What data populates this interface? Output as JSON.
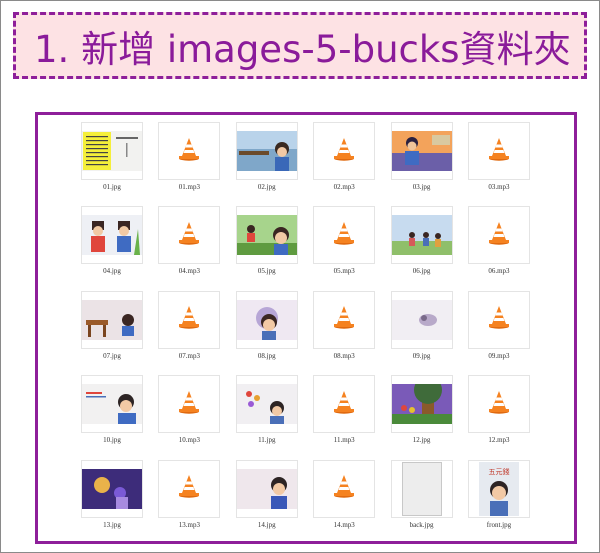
{
  "title": "1. 新增 images-5-bucks資料夾",
  "colors": {
    "banner_bg": "#fde2e4",
    "banner_border": "#8e1f9a",
    "title_text": "#8a1b9a",
    "panel_border": "#8e1f9a",
    "vlc_orange": "#f58220"
  },
  "files": [
    {
      "name": "01.jpg",
      "kind": "image",
      "art": "book-cover"
    },
    {
      "name": "01.mp3",
      "kind": "audio",
      "icon": "vlc-cone-icon"
    },
    {
      "name": "02.jpg",
      "kind": "image",
      "art": "boy-outdoor"
    },
    {
      "name": "02.mp3",
      "kind": "audio",
      "icon": "vlc-cone-icon"
    },
    {
      "name": "03.jpg",
      "kind": "image",
      "art": "sunset-girl"
    },
    {
      "name": "03.mp3",
      "kind": "audio",
      "icon": "vlc-cone-icon"
    },
    {
      "name": "04.jpg",
      "kind": "image",
      "art": "two-kids"
    },
    {
      "name": "04.mp3",
      "kind": "audio",
      "icon": "vlc-cone-icon"
    },
    {
      "name": "05.jpg",
      "kind": "image",
      "art": "kids-garden"
    },
    {
      "name": "05.mp3",
      "kind": "audio",
      "icon": "vlc-cone-icon"
    },
    {
      "name": "06.jpg",
      "kind": "image",
      "art": "kids-sky"
    },
    {
      "name": "06.mp3",
      "kind": "audio",
      "icon": "vlc-cone-icon"
    },
    {
      "name": "07.jpg",
      "kind": "image",
      "art": "desk-room"
    },
    {
      "name": "07.mp3",
      "kind": "audio",
      "icon": "vlc-cone-icon"
    },
    {
      "name": "08.jpg",
      "kind": "image",
      "art": "purple-child"
    },
    {
      "name": "08.mp3",
      "kind": "audio",
      "icon": "vlc-cone-icon"
    },
    {
      "name": "09.jpg",
      "kind": "image",
      "art": "pale-sketch"
    },
    {
      "name": "09.mp3",
      "kind": "audio",
      "icon": "vlc-cone-icon"
    },
    {
      "name": "10.jpg",
      "kind": "image",
      "art": "boy-writing"
    },
    {
      "name": "10.mp3",
      "kind": "audio",
      "icon": "vlc-cone-icon"
    },
    {
      "name": "11.jpg",
      "kind": "image",
      "art": "flowers-boy"
    },
    {
      "name": "11.mp3",
      "kind": "audio",
      "icon": "vlc-cone-icon"
    },
    {
      "name": "12.jpg",
      "kind": "image",
      "art": "tree-scene"
    },
    {
      "name": "12.mp3",
      "kind": "audio",
      "icon": "vlc-cone-icon"
    },
    {
      "name": "13.jpg",
      "kind": "image",
      "art": "purple-night"
    },
    {
      "name": "13.mp3",
      "kind": "audio",
      "icon": "vlc-cone-icon"
    },
    {
      "name": "14.jpg",
      "kind": "image",
      "art": "blue-girl"
    },
    {
      "name": "14.mp3",
      "kind": "audio",
      "icon": "vlc-cone-icon"
    },
    {
      "name": "back.jpg",
      "kind": "image",
      "art": "back-cover"
    },
    {
      "name": "front.jpg",
      "kind": "image",
      "art": "front-cover",
      "cover_title": "五元錢"
    }
  ]
}
